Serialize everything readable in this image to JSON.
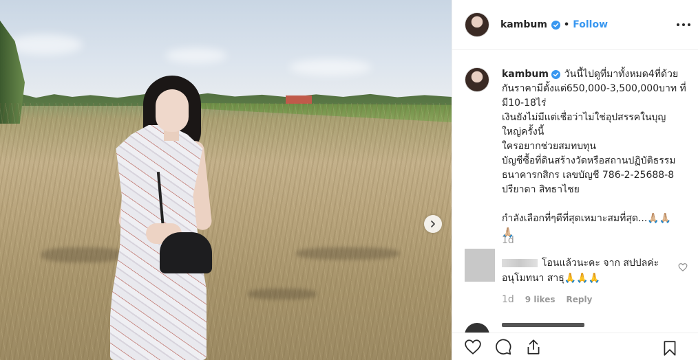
{
  "post": {
    "username": "kambum",
    "follow_label": "Follow",
    "separator": "•"
  },
  "caption": {
    "username": "kambum",
    "lines": [
      "วันนี้ไปดูที่มาทั้งหมด4ที่ด้วย",
      "กันราคามีตั้งแต่650,000-3,500,000บาท ที่",
      "มี10-18ไร่",
      "เงินยังไม่มีแต่เชื่อว่าไม่ใช่อุปสรรคในบุญ",
      "ใหญ่ครั้งนี้",
      "ใครอยากช่วยสมทบทุน",
      "บัญชีซื้อที่ดินสร้างวัดหรือสถานปฏิบัติธรรม",
      "ธนาคารกสิกร เลขบัญชี 786-2-25688-8",
      "ปรียาดา สิทธาไชย",
      "",
      "กำลังเลือกที่ๆดีที่สุดเหมาะสมที่สุด...🙏🏼🙏🏼",
      "🙏🏼"
    ],
    "time": "1d"
  },
  "comment": {
    "line1": "โอนแล้วนะคะ จาก สปปลค่ะ",
    "line2": "อนุโมทนา สาธุ🙏🙏🙏",
    "time": "1d",
    "likes": "9 likes",
    "reply": "Reply"
  },
  "colors": {
    "accent": "#3897f0",
    "verified": "#3897f0",
    "muted": "#999999",
    "text": "#262626"
  }
}
